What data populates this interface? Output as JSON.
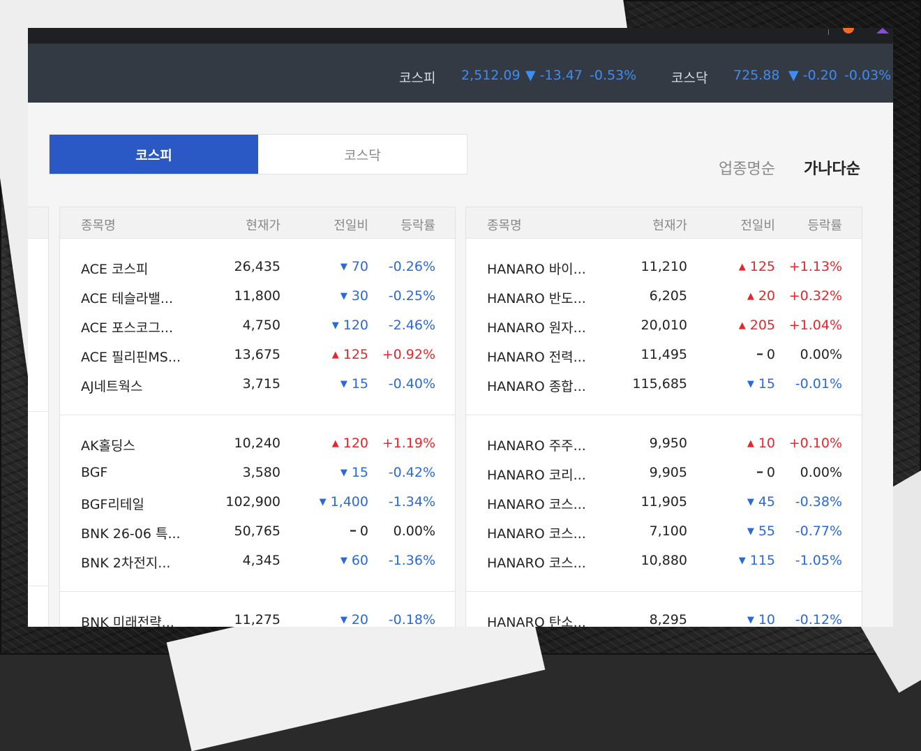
{
  "ticker": {
    "kospi": {
      "name": "코스피",
      "value": "2,512.09",
      "diff": "▼ -13.47",
      "rate": "-0.53%"
    },
    "kosdaq": {
      "name": "코스닥",
      "value": "725.88",
      "diff": "▼ -0.20",
      "rate": "-0.03%"
    }
  },
  "tabs": {
    "kospi": "코스피",
    "kosdaq": "코스닥"
  },
  "sort": {
    "by_sector": "업종명순",
    "by_name": "가나다순"
  },
  "columns": {
    "name": "종목명",
    "price": "현재가",
    "diff": "전일비",
    "rate": "등락률"
  },
  "colors": {
    "up": "#e8252b",
    "down": "#2a69d8",
    "accent": "#2a58c4",
    "ticker_bg": "#343a44"
  },
  "panel_a": [
    [
      {
        "name": "ACE 코스피",
        "price": "26,435",
        "dir": "down",
        "diff": "70",
        "rate": "-0.26%"
      },
      {
        "name": "ACE 테슬라밸...",
        "price": "11,800",
        "dir": "down",
        "diff": "30",
        "rate": "-0.25%"
      },
      {
        "name": "ACE 포스코그...",
        "price": "4,750",
        "dir": "down",
        "diff": "120",
        "rate": "-2.46%"
      },
      {
        "name": "ACE 필리핀MS...",
        "price": "13,675",
        "dir": "up",
        "diff": "125",
        "rate": "+0.92%"
      },
      {
        "name": "AJ네트웍스",
        "price": "3,715",
        "dir": "down",
        "diff": "15",
        "rate": "-0.40%"
      }
    ],
    [
      {
        "name": "AK홀딩스",
        "price": "10,240",
        "dir": "up",
        "diff": "120",
        "rate": "+1.19%"
      },
      {
        "name": "BGF",
        "price": "3,580",
        "dir": "down",
        "diff": "15",
        "rate": "-0.42%"
      },
      {
        "name": "BGF리테일",
        "price": "102,900",
        "dir": "down",
        "diff": "1,400",
        "rate": "-1.34%"
      },
      {
        "name": "BNK 26-06 특...",
        "price": "50,765",
        "dir": "flat",
        "diff": "0",
        "rate": "0.00%"
      },
      {
        "name": "BNK 2차전지...",
        "price": "4,345",
        "dir": "down",
        "diff": "60",
        "rate": "-1.36%"
      }
    ],
    [
      {
        "name": "BNK 미래전략...",
        "price": "11,275",
        "dir": "down",
        "diff": "20",
        "rate": "-0.18%"
      }
    ]
  ],
  "panel_b": [
    [
      {
        "name": "HANARO 바이...",
        "price": "11,210",
        "dir": "up",
        "diff": "125",
        "rate": "+1.13%"
      },
      {
        "name": "HANARO 반도...",
        "price": "6,205",
        "dir": "up",
        "diff": "20",
        "rate": "+0.32%"
      },
      {
        "name": "HANARO 원자...",
        "price": "20,010",
        "dir": "up",
        "diff": "205",
        "rate": "+1.04%"
      },
      {
        "name": "HANARO 전력...",
        "price": "11,495",
        "dir": "flat",
        "diff": "0",
        "rate": "0.00%"
      },
      {
        "name": "HANARO 종합...",
        "price": "115,685",
        "dir": "down",
        "diff": "15",
        "rate": "-0.01%"
      }
    ],
    [
      {
        "name": "HANARO 주주...",
        "price": "9,950",
        "dir": "up",
        "diff": "10",
        "rate": "+0.10%"
      },
      {
        "name": "HANARO 코리...",
        "price": "9,905",
        "dir": "flat",
        "diff": "0",
        "rate": "0.00%"
      },
      {
        "name": "HANARO 코스...",
        "price": "11,905",
        "dir": "down",
        "diff": "45",
        "rate": "-0.38%"
      },
      {
        "name": "HANARO 코스...",
        "price": "7,100",
        "dir": "down",
        "diff": "55",
        "rate": "-0.77%"
      },
      {
        "name": "HANARO 코스...",
        "price": "10,880",
        "dir": "down",
        "diff": "115",
        "rate": "-1.05%"
      }
    ],
    [
      {
        "name": "HANARO 탄소...",
        "price": "8,295",
        "dir": "down",
        "diff": "10",
        "rate": "-0.12%"
      }
    ]
  ]
}
